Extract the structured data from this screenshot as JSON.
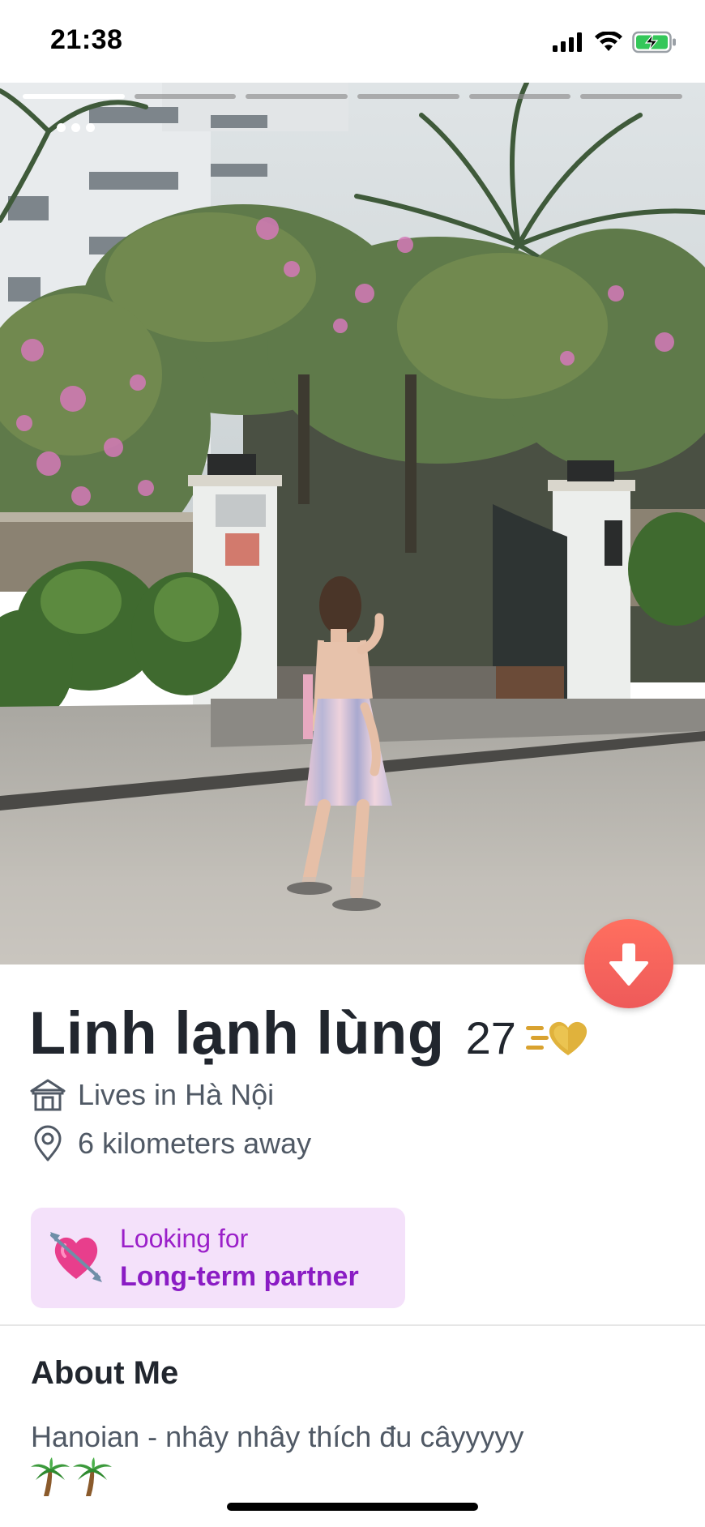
{
  "status_bar": {
    "time": "21:38"
  },
  "photo": {
    "page_count": 6,
    "active_page": 1
  },
  "profile": {
    "name": "Linh lạnh lùng",
    "age": "27",
    "lives_in": "Lives in Hà Nội",
    "distance": "6 kilometers away"
  },
  "looking_for": {
    "label": "Looking for",
    "value": "Long-term partner"
  },
  "about": {
    "title": "About Me",
    "text": "Hanoian - nhây nhây thích đu câyyyyy",
    "emojis": [
      "palm-tree",
      "palm-tree"
    ]
  },
  "colors": {
    "collapse_button": "#ee5a5a",
    "looking_card_bg": "#f4e1fa",
    "looking_accent": "#8a1cc4",
    "text_primary": "#21262e",
    "text_secondary": "#505965"
  }
}
